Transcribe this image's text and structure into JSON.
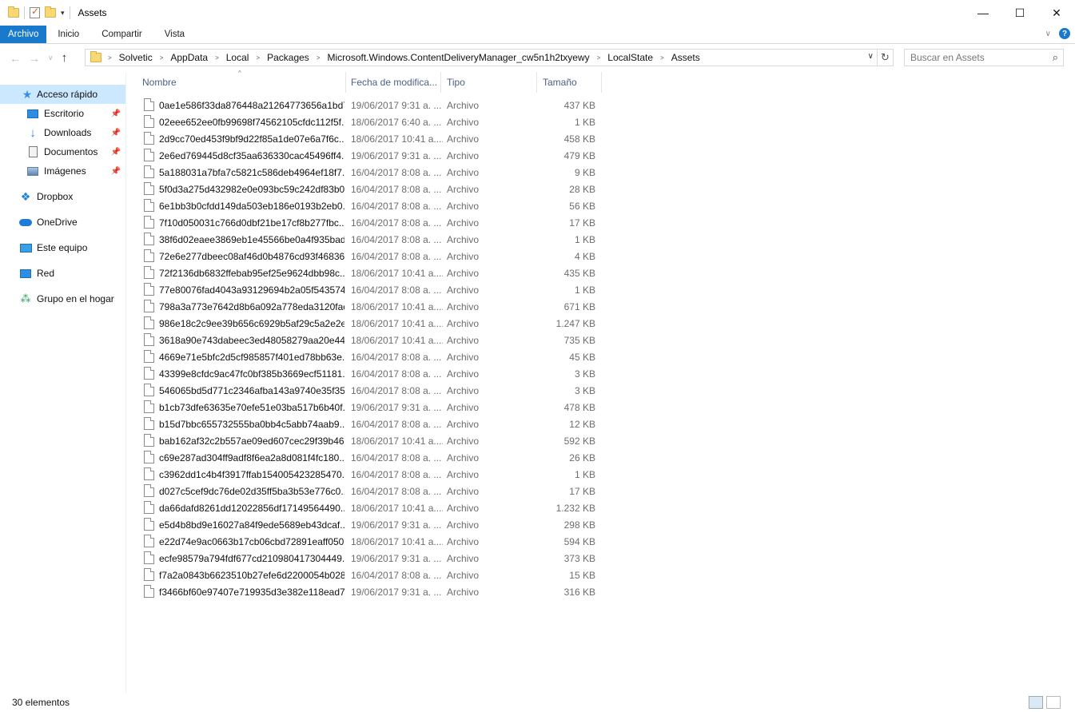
{
  "window": {
    "title": "Assets",
    "controls": [
      "—",
      "☐",
      "✕"
    ]
  },
  "ribbon": {
    "tabs": [
      "Archivo",
      "Inicio",
      "Compartir",
      "Vista"
    ]
  },
  "address": {
    "crumbs": [
      "Solvetic",
      "AppData",
      "Local",
      "Packages",
      "Microsoft.Windows.ContentDeliveryManager_cw5n1h2txyewy",
      "LocalState",
      "Assets"
    ]
  },
  "search": {
    "placeholder": "Buscar en Assets"
  },
  "sidebar": {
    "items": [
      {
        "label": "Acceso rápido",
        "icon": "star-icon",
        "selected": true
      },
      {
        "label": "Escritorio",
        "icon": "desktop-icon",
        "pinned": true
      },
      {
        "label": "Downloads",
        "icon": "download-icon",
        "pinned": true
      },
      {
        "label": "Documentos",
        "icon": "document-icon",
        "pinned": true
      },
      {
        "label": "Imágenes",
        "icon": "pictures-icon",
        "pinned": true
      },
      {
        "label": "Dropbox",
        "icon": "dropbox-icon"
      },
      {
        "label": "OneDrive",
        "icon": "onedrive-icon"
      },
      {
        "label": "Este equipo",
        "icon": "computer-icon"
      },
      {
        "label": "Red",
        "icon": "network-icon"
      },
      {
        "label": "Grupo en el hogar",
        "icon": "homegroup-icon"
      }
    ]
  },
  "columns": {
    "name": "Nombre",
    "date": "Fecha de modifica...",
    "type": "Tipo",
    "size": "Tamaño"
  },
  "files": [
    {
      "name": "0ae1e586f33da876448a21264773656a1bd7...",
      "date": "19/06/2017 9:31 a. ...",
      "type": "Archivo",
      "size": "437 KB"
    },
    {
      "name": "02eee652ee0fb99698f74562105cfdc112f5f...",
      "date": "18/06/2017 6:40 a. ...",
      "type": "Archivo",
      "size": "1 KB"
    },
    {
      "name": "2d9cc70ed453f9bf9d22f85a1de07e6a7f6c...",
      "date": "18/06/2017 10:41 a....",
      "type": "Archivo",
      "size": "458 KB"
    },
    {
      "name": "2e6ed769445d8cf35aa636330cac45496ff4...",
      "date": "19/06/2017 9:31 a. ...",
      "type": "Archivo",
      "size": "479 KB"
    },
    {
      "name": "5a188031a7bfa7c5821c586deb4964ef18f7...",
      "date": "16/04/2017 8:08 a. ...",
      "type": "Archivo",
      "size": "9 KB"
    },
    {
      "name": "5f0d3a275d432982e0e093bc59c242df83b0...",
      "date": "16/04/2017 8:08 a. ...",
      "type": "Archivo",
      "size": "28 KB"
    },
    {
      "name": "6e1bb3b0cfdd149da503eb186e0193b2eb0...",
      "date": "16/04/2017 8:08 a. ...",
      "type": "Archivo",
      "size": "56 KB"
    },
    {
      "name": "7f10d050031c766d0dbf21be17cf8b277fbc...",
      "date": "16/04/2017 8:08 a. ...",
      "type": "Archivo",
      "size": "17 KB"
    },
    {
      "name": "38f6d02eaee3869eb1e45566be0a4f935bad...",
      "date": "16/04/2017 8:08 a. ...",
      "type": "Archivo",
      "size": "1 KB"
    },
    {
      "name": "72e6e277dbeec08af46d0b4876cd93f46836...",
      "date": "16/04/2017 8:08 a. ...",
      "type": "Archivo",
      "size": "4 KB"
    },
    {
      "name": "72f2136db6832ffebab95ef25e9624dbb98c...",
      "date": "18/06/2017 10:41 a....",
      "type": "Archivo",
      "size": "435 KB"
    },
    {
      "name": "77e80076fad4043a93129694b2a05f543574...",
      "date": "16/04/2017 8:08 a. ...",
      "type": "Archivo",
      "size": "1 KB"
    },
    {
      "name": "798a3a773e7642d8b6a092a778eda3120fac...",
      "date": "18/06/2017 10:41 a....",
      "type": "Archivo",
      "size": "671 KB"
    },
    {
      "name": "986e18c2c9ee39b656c6929b5af29c5a2e2e...",
      "date": "18/06/2017 10:41 a....",
      "type": "Archivo",
      "size": "1.247 KB"
    },
    {
      "name": "3618a90e743dabeec3ed48058279aa20e44...",
      "date": "18/06/2017 10:41 a....",
      "type": "Archivo",
      "size": "735 KB"
    },
    {
      "name": "4669e71e5bfc2d5cf985857f401ed78bb63e...",
      "date": "16/04/2017 8:08 a. ...",
      "type": "Archivo",
      "size": "45 KB"
    },
    {
      "name": "43399e8cfdc9ac47fc0bf385b3669ecf51181...",
      "date": "16/04/2017 8:08 a. ...",
      "type": "Archivo",
      "size": "3 KB"
    },
    {
      "name": "546065bd5d771c2346afba143a9740e35f35...",
      "date": "16/04/2017 8:08 a. ...",
      "type": "Archivo",
      "size": "3 KB"
    },
    {
      "name": "b1cb73dfe63635e70efe51e03ba517b6b40f...",
      "date": "19/06/2017 9:31 a. ...",
      "type": "Archivo",
      "size": "478 KB"
    },
    {
      "name": "b15d7bbc655732555ba0bb4c5abb74aab9...",
      "date": "16/04/2017 8:08 a. ...",
      "type": "Archivo",
      "size": "12 KB"
    },
    {
      "name": "bab162af32c2b557ae09ed607cec29f39b46...",
      "date": "18/06/2017 10:41 a....",
      "type": "Archivo",
      "size": "592 KB"
    },
    {
      "name": "c69e287ad304ff9adf8f6ea2a8d081f4fc180...",
      "date": "16/04/2017 8:08 a. ...",
      "type": "Archivo",
      "size": "26 KB"
    },
    {
      "name": "c3962dd1c4b4f3917ffab154005423285470...",
      "date": "16/04/2017 8:08 a. ...",
      "type": "Archivo",
      "size": "1 KB"
    },
    {
      "name": "d027c5cef9dc76de02d35ff5ba3b53e776c0...",
      "date": "16/04/2017 8:08 a. ...",
      "type": "Archivo",
      "size": "17 KB"
    },
    {
      "name": "da66dafd8261dd12022856df17149564490...",
      "date": "18/06/2017 10:41 a....",
      "type": "Archivo",
      "size": "1.232 KB"
    },
    {
      "name": "e5d4b8bd9e16027a84f9ede5689eb43dcaf...",
      "date": "19/06/2017 9:31 a. ...",
      "type": "Archivo",
      "size": "298 KB"
    },
    {
      "name": "e22d74e9ac0663b17cb06cbd72891eaff050...",
      "date": "18/06/2017 10:41 a....",
      "type": "Archivo",
      "size": "594 KB"
    },
    {
      "name": "ecfe98579a794fdf677cd210980417304449...",
      "date": "19/06/2017 9:31 a. ...",
      "type": "Archivo",
      "size": "373 KB"
    },
    {
      "name": "f7a2a0843b6623510b27efe6d2200054b028...",
      "date": "16/04/2017 8:08 a. ...",
      "type": "Archivo",
      "size": "15 KB"
    },
    {
      "name": "f3466bf60e97407e719935d3e382e118ead7...",
      "date": "19/06/2017 9:31 a. ...",
      "type": "Archivo",
      "size": "316 KB"
    }
  ],
  "status": {
    "count": "30 elementos"
  },
  "colors": {
    "accent": "#1979ca",
    "selection": "#cce8ff",
    "header_text": "#4d6185"
  }
}
